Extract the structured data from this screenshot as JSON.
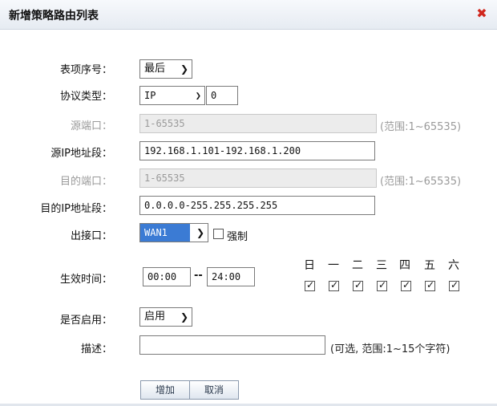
{
  "window": {
    "title": "新增策略路由列表",
    "close_icon": "close-x-red"
  },
  "form": {
    "item_order": {
      "label": "表项序号：",
      "value": "最后"
    },
    "protocol": {
      "label": "协议类型：",
      "type": "IP",
      "number": "0"
    },
    "src_port": {
      "label": "源端口：",
      "placeholder": "1-65535",
      "hint": "(范围:1~65535)"
    },
    "src_ip": {
      "label": "源IP地址段：",
      "value": "192.168.1.101-192.168.1.200"
    },
    "dst_port": {
      "label": "目的端口：",
      "placeholder": "1-65535",
      "hint": "(范围:1~65535)"
    },
    "dst_ip": {
      "label": "目的IP地址段：",
      "value": "0.0.0.0-255.255.255.255"
    },
    "out_iface": {
      "label": "出接口：",
      "value": "WAN1",
      "force_label": "强制",
      "force_checked": false
    },
    "active_time": {
      "label": "生效时间：",
      "start": "00:00",
      "separator": "--",
      "end": "24:00",
      "days": [
        {
          "name": "日",
          "checked": true
        },
        {
          "name": "一",
          "checked": true
        },
        {
          "name": "二",
          "checked": true
        },
        {
          "name": "三",
          "checked": true
        },
        {
          "name": "四",
          "checked": true
        },
        {
          "name": "五",
          "checked": true
        },
        {
          "name": "六",
          "checked": true
        }
      ]
    },
    "enabled": {
      "label": "是否启用：",
      "value": "启用"
    },
    "description": {
      "label": "描述：",
      "value": "",
      "hint": "(可选, 范围:1~15个字符)"
    }
  },
  "buttons": {
    "add": "增加",
    "cancel": "取消"
  }
}
